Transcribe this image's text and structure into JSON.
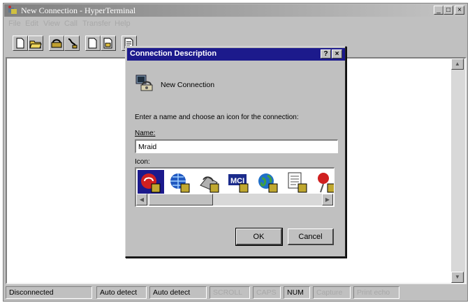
{
  "window": {
    "title": "New Connection - HyperTerminal",
    "caption_buttons": [
      "_",
      "□",
      "×"
    ]
  },
  "menu": [
    {
      "label": "File",
      "key": "F"
    },
    {
      "label": "Edit",
      "key": "E"
    },
    {
      "label": "View",
      "key": "V"
    },
    {
      "label": "Call",
      "key": "C"
    },
    {
      "label": "Transfer",
      "key": "T"
    },
    {
      "label": "Help",
      "key": "H"
    }
  ],
  "toolbar": [
    "new-icon",
    "open-icon",
    "connect-icon",
    "disconnect-icon",
    "send-icon",
    "receive-icon",
    "properties-icon"
  ],
  "dialog": {
    "title": "Connection Description",
    "help_button": "?",
    "close_button": "×",
    "header_label": "New Connection",
    "instruction": "Enter a name and choose an icon for the connection:",
    "name_label": "Name:",
    "name_value": "Mraid",
    "icon_label": "Icon:",
    "icons": [
      "red-phone-icon",
      "globe-icon",
      "phone-icon",
      "mci-icon",
      "world-icon",
      "document-icon",
      "pushpin-icon"
    ],
    "selected_icon": 0,
    "ok_label": "OK",
    "cancel_label": "Cancel"
  },
  "status": {
    "connection": "Disconnected",
    "detect1": "Auto detect",
    "detect2": "Auto detect",
    "scroll": "SCROLL",
    "caps": "CAPS",
    "num": "NUM",
    "capture": "Capture",
    "print_echo": "Print echo"
  },
  "colors": {
    "dialog_title_bar": "#1c1a8c",
    "window_face": "#c0c0c0",
    "selected_icon_bg": "#1c1a8c"
  }
}
